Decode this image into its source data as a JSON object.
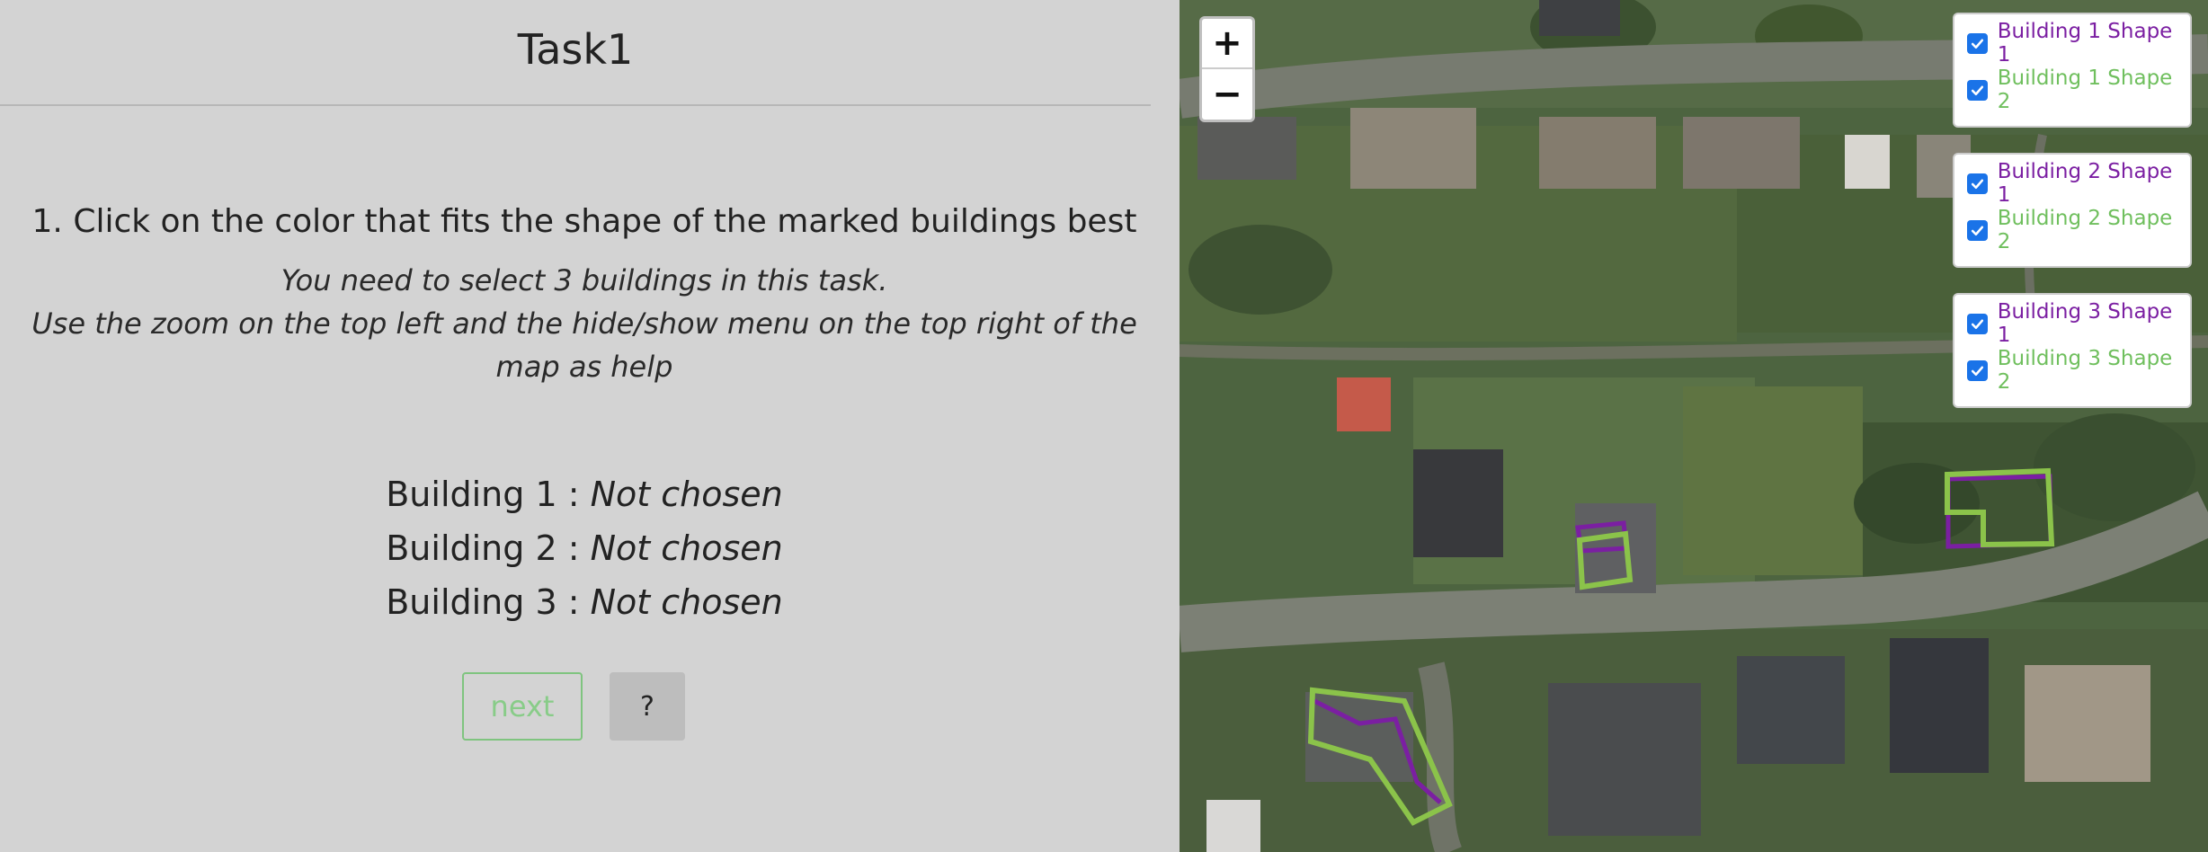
{
  "task": {
    "title": "Task1",
    "instruction": "1. Click on the color that fits the shape of the marked buildings best",
    "note_line1": "You need to select 3 buildings in this task.",
    "note_line2": "Use the zoom on the top left and the hide/show menu on the top right of the map as help",
    "buildings": [
      {
        "label": "Building 1 :",
        "status": "Not chosen"
      },
      {
        "label": "Building 2 :",
        "status": "Not chosen"
      },
      {
        "label": "Building 3 :",
        "status": "Not chosen"
      }
    ],
    "next_label": "next",
    "help_label": "?"
  },
  "map": {
    "zoom_in_label": "+",
    "zoom_out_label": "−",
    "layers": [
      {
        "shape1": "Building 1 Shape 1",
        "shape2": "Building 1 Shape 2",
        "shape1_checked": true,
        "shape2_checked": true
      },
      {
        "shape1": "Building 2 Shape 1",
        "shape2": "Building 2 Shape 2",
        "shape1_checked": true,
        "shape2_checked": true
      },
      {
        "shape1": "Building 3 Shape 1",
        "shape2": "Building 3 Shape 2",
        "shape1_checked": true,
        "shape2_checked": true
      }
    ]
  },
  "colors": {
    "shape1": "#7b1fa2",
    "shape2": "#8bc34a",
    "checkbox": "#1a73e8",
    "next_border": "#7fc47f"
  },
  "icons": {
    "checkbox": "checkmark-icon",
    "zoom_in": "plus-icon",
    "zoom_out": "minus-icon"
  }
}
